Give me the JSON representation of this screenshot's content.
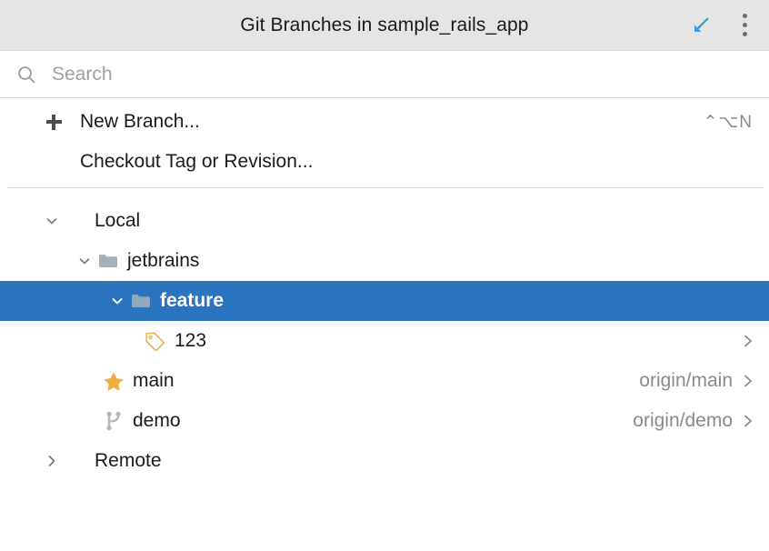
{
  "window": {
    "title": "Git Branches in sample_rails_app",
    "detach_icon": "arrow-down-left-icon",
    "menu_icon": "more-vertical-icon",
    "header_bg": "#e5e5e5",
    "accent": "#2a74c0"
  },
  "search": {
    "icon": "search-icon",
    "value": "",
    "placeholder": "Search"
  },
  "actions": [
    {
      "id": "new-branch",
      "icon": "plus-icon",
      "label": "New Branch...",
      "shortcut": "⌃⌥N"
    },
    {
      "id": "checkout-tag-or-revision",
      "icon": "",
      "label": "Checkout Tag or Revision...",
      "shortcut": ""
    }
  ],
  "tree": [
    {
      "id": "local",
      "label": "Local",
      "twisty": "chevron-down-icon",
      "icon": "",
      "indent": 0,
      "selected": false,
      "tracking": "",
      "chevron": false
    },
    {
      "id": "jetbrains",
      "label": "jetbrains",
      "twisty": "chevron-down-icon",
      "icon": "folder-icon",
      "indent": 1,
      "selected": false,
      "tracking": "",
      "chevron": false
    },
    {
      "id": "feature",
      "label": "feature",
      "twisty": "chevron-down-icon",
      "icon": "folder-icon",
      "indent": 2,
      "selected": true,
      "tracking": "",
      "chevron": false
    },
    {
      "id": "123",
      "label": "123",
      "twisty": "",
      "icon": "tag-icon",
      "indent": 3,
      "selected": false,
      "tracking": "",
      "chevron": true
    },
    {
      "id": "main",
      "label": "main",
      "twisty": "",
      "icon": "star-icon",
      "indent": 1,
      "selected": false,
      "tracking": "origin/main",
      "chevron": true
    },
    {
      "id": "demo",
      "label": "demo",
      "twisty": "",
      "icon": "branch-icon",
      "indent": 1,
      "selected": false,
      "tracking": "origin/demo",
      "chevron": true
    },
    {
      "id": "remote",
      "label": "Remote",
      "twisty": "chevron-right-icon",
      "icon": "",
      "indent": 0,
      "selected": false,
      "tracking": "",
      "chevron": false
    }
  ]
}
